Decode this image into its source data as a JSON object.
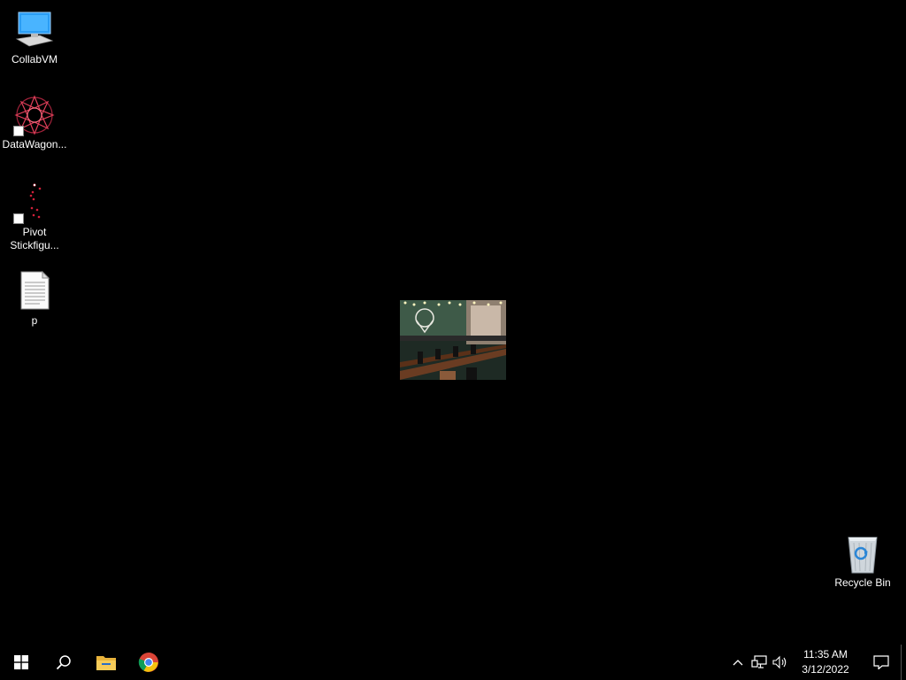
{
  "desktop": {
    "icons": [
      {
        "label": "CollabVM",
        "icon": "computer-icon"
      },
      {
        "label": "DataWagon...",
        "icon": "datawagon-shortcut-icon"
      },
      {
        "label": "Pivot\nStickfigu...",
        "line1": "Pivot",
        "line2": "Stickfigu...",
        "icon": "pivot-shortcut-icon"
      },
      {
        "label": "p",
        "icon": "text-document-icon"
      },
      {
        "label": "Recycle Bin",
        "icon": "recycle-bin-icon"
      }
    ],
    "wallpaper": {
      "description_icon": "restaurant-photo"
    }
  },
  "taskbar": {
    "start": {
      "icon": "windows-logo-icon"
    },
    "search": {
      "icon": "search-icon"
    },
    "pinned": [
      {
        "name": "File Explorer",
        "icon": "folder-icon"
      },
      {
        "name": "Google Chrome",
        "icon": "chrome-icon"
      }
    ],
    "tray": {
      "chevron_icon": "chevron-up-icon",
      "network_icon": "network-icon",
      "volume_icon": "volume-icon",
      "time": "11:35 AM",
      "date": "3/12/2022",
      "notification_icon": "action-center-icon"
    }
  }
}
